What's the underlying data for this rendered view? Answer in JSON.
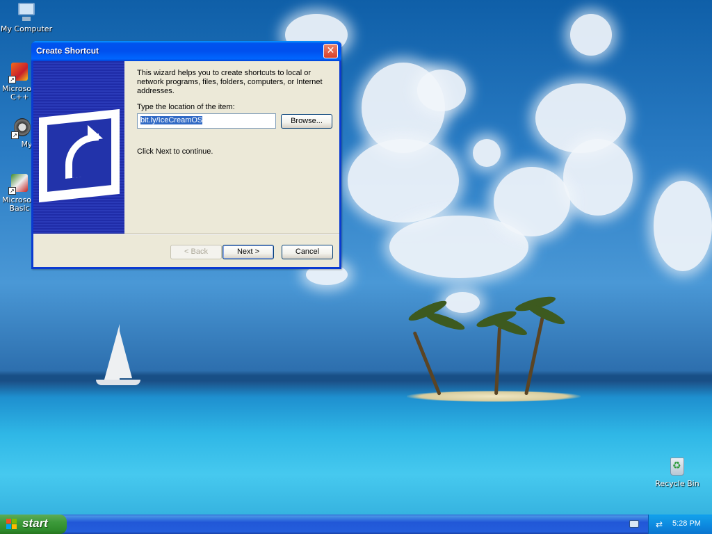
{
  "desktop": {
    "icons": [
      {
        "label": "My Computer"
      },
      {
        "label": "Microsoft\nC++"
      },
      {
        "label": "Myp"
      },
      {
        "label": "Microsoft\nBasic"
      },
      {
        "label": "Recycle Bin"
      }
    ]
  },
  "dialog": {
    "title": "Create Shortcut",
    "close_glyph": "✕",
    "intro": "This wizard helps you to create shortcuts to local or network programs, files, folders, computers, or Internet addresses.",
    "location_label": "Type the location of the item:",
    "location_value": "bit.ly/IceCreamOS",
    "browse_label": "Browse...",
    "next_hint": "Click Next to continue.",
    "back_label": "< Back",
    "next_label": "Next >",
    "cancel_label": "Cancel"
  },
  "taskbar": {
    "start_label": "start",
    "clock": "5:28 PM"
  },
  "colors": {
    "title_blue": "#0053ee",
    "dialog_bg": "#ece9d8",
    "start_green": "#3c9a3a",
    "tray_blue": "#0c87de"
  }
}
